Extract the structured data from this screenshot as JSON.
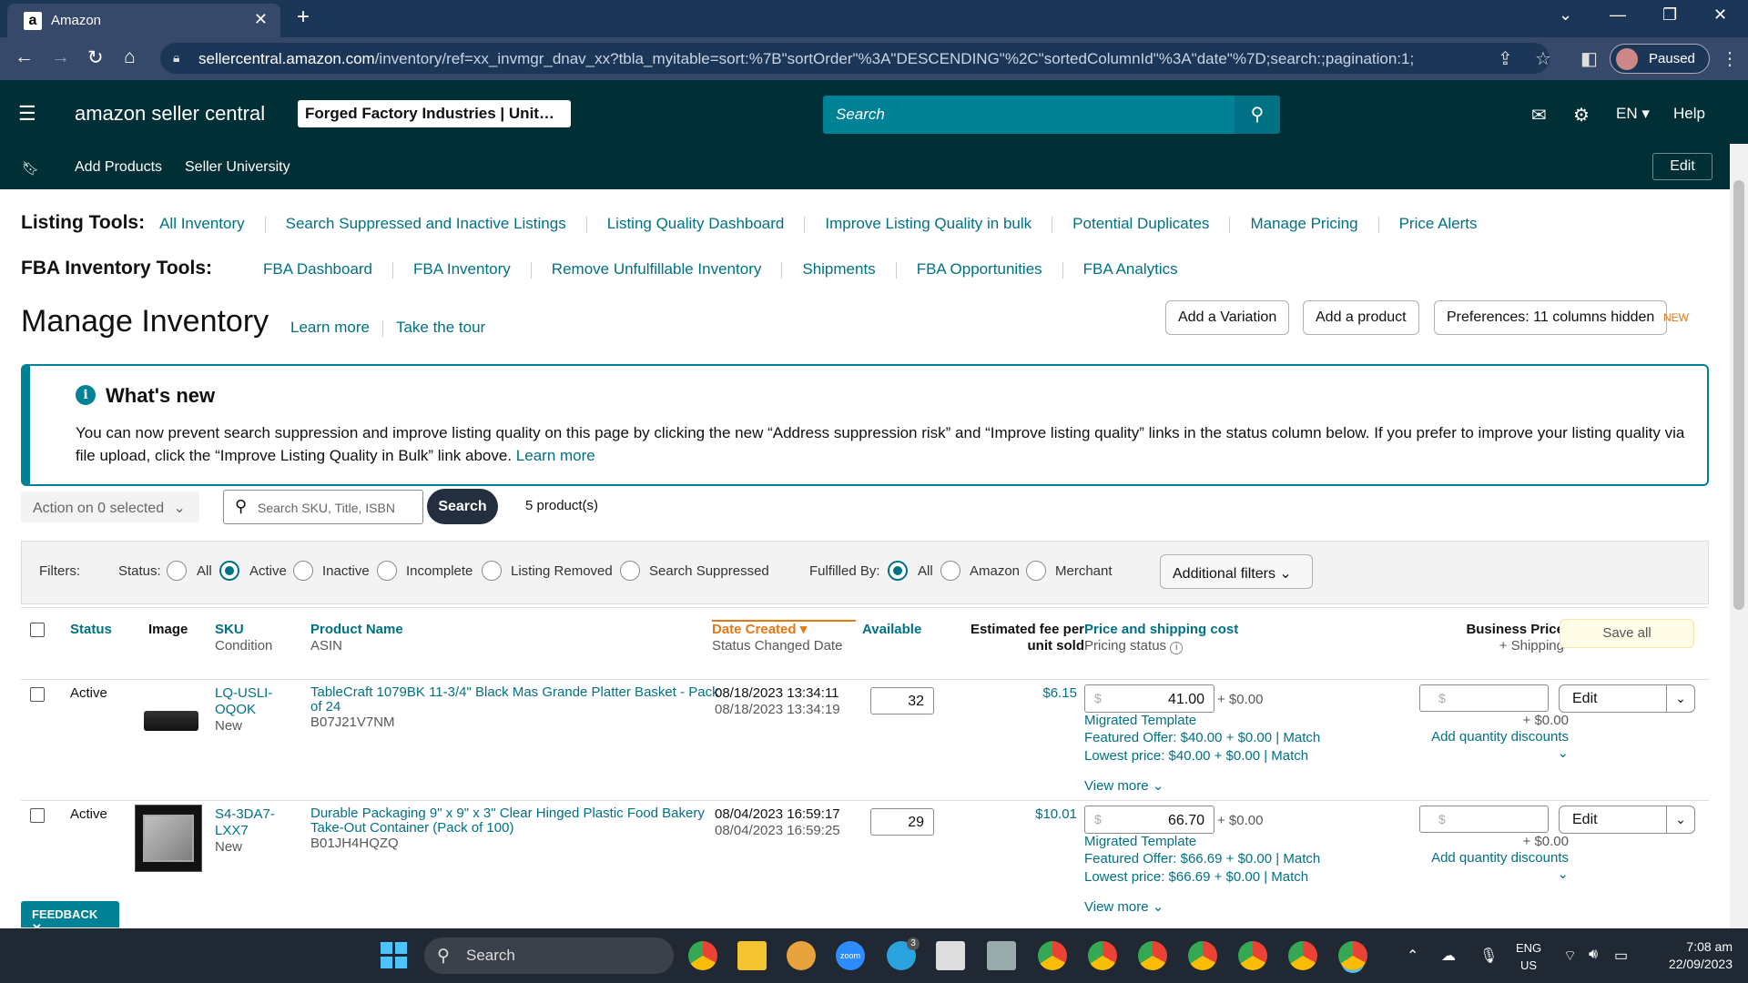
{
  "browser": {
    "tab_title": "Amazon",
    "favicon": "a",
    "close_tab": "✕",
    "new_tab": "+",
    "url_host": "sellercentral.amazon.com",
    "url_path": "/inventory/ref=xx_invmgr_dnav_xx?tbla_myitable=sort:%7B\"sortOrder\"%3A\"DESCENDING\"%2C\"sortedColumnId\"%3A\"date\"%7D;search:;pagination:1;",
    "profile_label": "Paused"
  },
  "header": {
    "logo": "amazon seller central",
    "store": "Forged Factory Industries | Unit…",
    "search_placeholder": "Search",
    "lang": "EN ▾",
    "help": "Help"
  },
  "subnav": {
    "items": [
      "Add Products",
      "Seller University"
    ],
    "edit": "Edit"
  },
  "listing_tools": {
    "label": "Listing Tools:",
    "links": [
      "All Inventory",
      "Search Suppressed and Inactive Listings",
      "Listing Quality Dashboard",
      "Improve Listing Quality in bulk",
      "Potential Duplicates",
      "Manage Pricing",
      "Price Alerts"
    ]
  },
  "fba_tools": {
    "label": "FBA Inventory Tools:",
    "links": [
      "FBA Dashboard",
      "FBA Inventory",
      "Remove Unfulfillable Inventory",
      "Shipments",
      "FBA Opportunities",
      "FBA Analytics"
    ]
  },
  "page": {
    "title": "Manage Inventory",
    "learn_more": "Learn more",
    "take_tour": "Take the tour",
    "add_variation": "Add a Variation",
    "add_product": "Add a product",
    "preferences": "Preferences: 11 columns hidden",
    "new_tag": "NEW"
  },
  "whats_new": {
    "heading": "What's new",
    "body": "You can now prevent search suppression and improve listing quality on this page by clicking the new “Address suppression risk” and “Improve listing quality” links in the status column below. If you prefer to improve your listing quality via file upload, click the “Improve Listing Quality in Bulk” link above.",
    "link": "Learn more"
  },
  "actions": {
    "action_select": "Action on 0 selected",
    "search_placeholder": "Search SKU, Title, ISBN",
    "search_btn": "Search",
    "count": "5 product(s)"
  },
  "filters": {
    "label": "Filters:",
    "status_label": "Status:",
    "status_options": [
      "All",
      "Active",
      "Inactive",
      "Incomplete",
      "Listing Removed",
      "Search Suppressed"
    ],
    "status_selected": "Active",
    "fulfilled_label": "Fulfilled By:",
    "fulfilled_options": [
      "All",
      "Amazon",
      "Merchant"
    ],
    "fulfilled_selected": "All",
    "additional": "Additional filters"
  },
  "columns": {
    "status": "Status",
    "image": "Image",
    "sku": "SKU",
    "condition": "Condition",
    "product_name": "Product Name",
    "asin": "ASIN",
    "date_created": "Date Created",
    "status_changed": "Status Changed Date",
    "available": "Available",
    "fee": "Estimated fee per unit sold",
    "price": "Price and shipping cost",
    "pricing_status": "Pricing status",
    "business_price": "Business Price",
    "shipping": "+ Shipping",
    "save_all": "Save all"
  },
  "rows": [
    {
      "status": "Active",
      "sku": "LQ-USLI-OQOK",
      "condition": "New",
      "name": "TableCraft 1079BK 11-3/4\" Black Mas Grande Platter Basket - Pack of 24",
      "asin": "B07J21V7NM",
      "date_created": "08/18/2023 13:34:11",
      "status_changed": "08/18/2023 13:34:19",
      "available": "32",
      "fee": "$6.15",
      "price": "41.00",
      "shipping": "+ $0.00",
      "template": "Migrated Template",
      "featured": "Featured Offer: $40.00 + $0.00",
      "lowest": "Lowest price: $40.00 + $0.00",
      "match": "Match",
      "view_more": "View more",
      "bp_shipping": "+ $0.00",
      "qty_discounts": "Add quantity discounts",
      "edit": "Edit"
    },
    {
      "status": "Active",
      "sku": "S4-3DA7-LXX7",
      "condition": "New",
      "name": "Durable Packaging 9\" x 9\" x 3\" Clear Hinged Plastic Food Bakery Take-Out Container (Pack of 100)",
      "asin": "B01JH4HQZQ",
      "date_created": "08/04/2023 16:59:17",
      "status_changed": "08/04/2023 16:59:25",
      "available": "29",
      "fee": "$10.01",
      "price": "66.70",
      "shipping": "+ $0.00",
      "template": "Migrated Template",
      "featured": "Featured Offer: $66.69 + $0.00",
      "lowest": "Lowest price: $66.69 + $0.00",
      "match": "Match",
      "view_more": "View more",
      "bp_shipping": "+ $0.00",
      "qty_discounts": "Add quantity discounts",
      "edit": "Edit"
    }
  ],
  "feedback": "FEEDBACK ✕",
  "taskbar": {
    "search": "Search",
    "lang_top": "ENG",
    "lang_bottom": "US",
    "time": "7:08 am",
    "date": "22/09/2023",
    "zoom_label": "zoom",
    "telegram_badge": "3"
  }
}
